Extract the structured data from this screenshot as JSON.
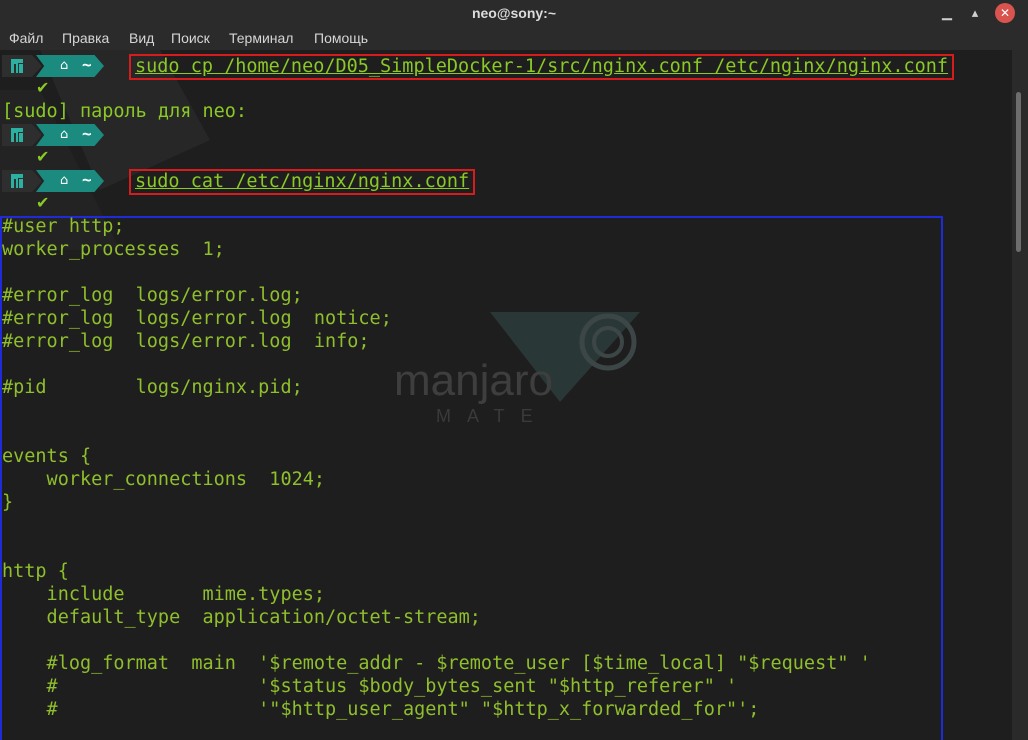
{
  "window": {
    "title": "neo@sony:~",
    "buttons": [
      "minimize",
      "maximize",
      "close"
    ]
  },
  "menu": {
    "items": [
      "Файл",
      "Правка",
      "Вид",
      "Поиск",
      "Терминал",
      "Помощь"
    ]
  },
  "colors": {
    "text": "#8ac926",
    "prompt_segment": "#1a8b7e",
    "highlight_red": "#d61c1c",
    "highlight_blue": "#1f2bd8"
  },
  "watermark": {
    "brand": "manjaro",
    "edition": "MATE"
  },
  "prompt": {
    "home_icon": "home-icon",
    "dir": "~",
    "check": "✔"
  },
  "commands": {
    "cp": "sudo cp /home/neo/D05_SimpleDocker-1/src/nginx.conf /etc/nginx/nginx.conf",
    "sudo_prompt": "[sudo] пароль для neo:",
    "cat": "sudo cat /etc/nginx/nginx.conf"
  },
  "file_lines": [
    "#user http;",
    "worker_processes  1;",
    "",
    "#error_log  logs/error.log;",
    "#error_log  logs/error.log  notice;",
    "#error_log  logs/error.log  info;",
    "",
    "#pid        logs/nginx.pid;",
    "",
    "",
    "events {",
    "    worker_connections  1024;",
    "}",
    "",
    "",
    "http {",
    "    include       mime.types;",
    "    default_type  application/octet-stream;",
    "",
    "    #log_format  main  '$remote_addr - $remote_user [$time_local] \"$request\" '",
    "    #                  '$status $body_bytes_sent \"$http_referer\" '",
    "    #                  '\"$http_user_agent\" \"$http_x_forwarded_for\"';"
  ]
}
